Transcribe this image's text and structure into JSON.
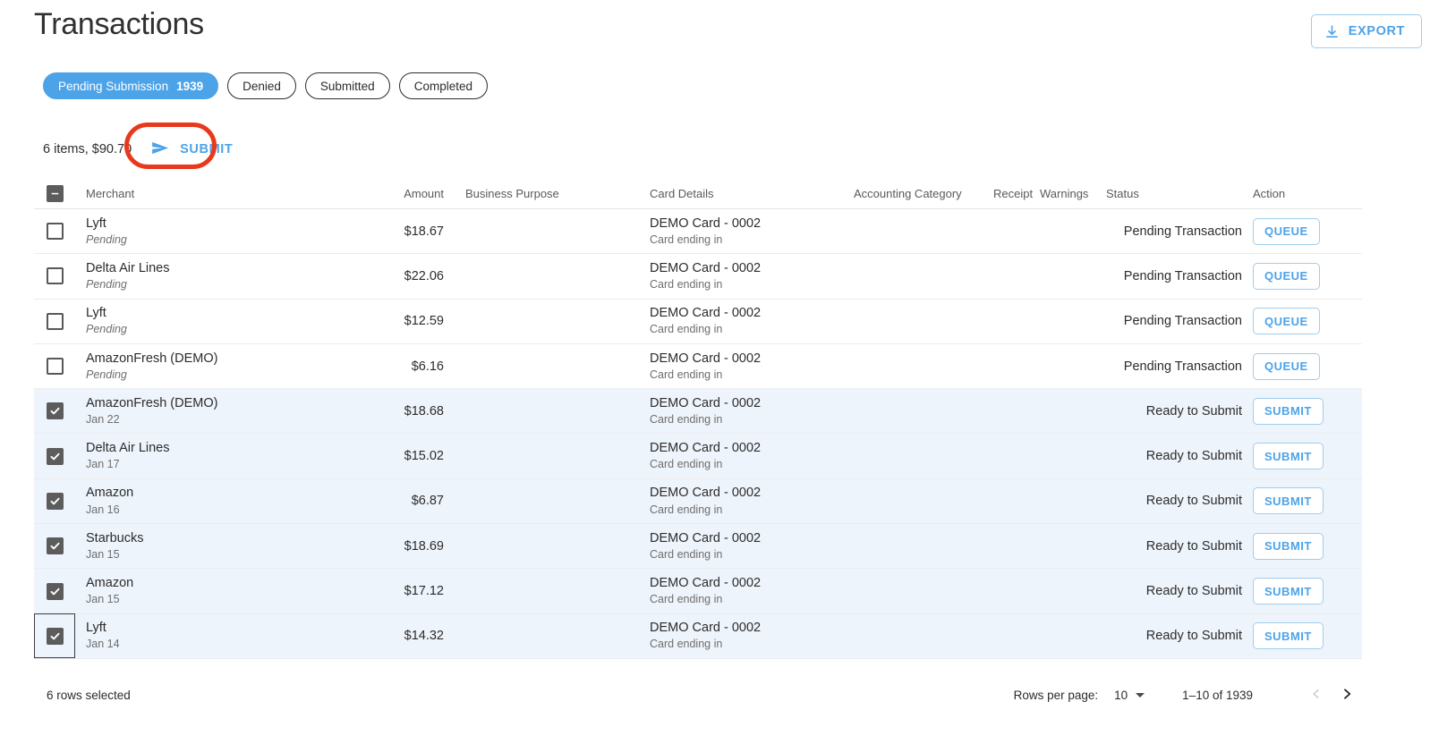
{
  "header": {
    "title": "Transactions",
    "export_label": "EXPORT",
    "export_icon": "download-icon"
  },
  "filters": [
    {
      "label": "Pending Submission",
      "count": "1939",
      "active": true
    },
    {
      "label": "Denied",
      "count": "",
      "active": false
    },
    {
      "label": "Submitted",
      "count": "",
      "active": false
    },
    {
      "label": "Completed",
      "count": "",
      "active": false
    }
  ],
  "toolbar": {
    "summary": "6 items, $90.70",
    "submit_label": "SUBMIT",
    "submit_icon": "send-icon",
    "highlight_color": "#e8391c"
  },
  "table": {
    "columns": {
      "merchant": "Merchant",
      "amount": "Amount",
      "business_purpose": "Business Purpose",
      "card_details": "Card Details",
      "accounting_category": "Accounting Category",
      "receipt": "Receipt",
      "warnings": "Warnings",
      "status": "Status",
      "action": "Action"
    },
    "select_all_state": "indeterminate",
    "rows": [
      {
        "merchant": "Lyft",
        "sub": "Pending",
        "sub_italic": true,
        "amount": "$18.67",
        "business_purpose": "",
        "card": "DEMO Card - 0002",
        "card_sub": "Card ending in",
        "accounting_category": "",
        "receipt": "",
        "warnings": "",
        "status": "Pending Transaction",
        "action": "QUEUE",
        "selected": false,
        "focused": false
      },
      {
        "merchant": "Delta Air Lines",
        "sub": "Pending",
        "sub_italic": true,
        "amount": "$22.06",
        "business_purpose": "",
        "card": "DEMO Card - 0002",
        "card_sub": "Card ending in",
        "accounting_category": "",
        "receipt": "",
        "warnings": "",
        "status": "Pending Transaction",
        "action": "QUEUE",
        "selected": false,
        "focused": false
      },
      {
        "merchant": "Lyft",
        "sub": "Pending",
        "sub_italic": true,
        "amount": "$12.59",
        "business_purpose": "",
        "card": "DEMO Card - 0002",
        "card_sub": "Card ending in",
        "accounting_category": "",
        "receipt": "",
        "warnings": "",
        "status": "Pending Transaction",
        "action": "QUEUE",
        "selected": false,
        "focused": false
      },
      {
        "merchant": "AmazonFresh (DEMO)",
        "sub": "Pending",
        "sub_italic": true,
        "amount": "$6.16",
        "business_purpose": "",
        "card": "DEMO Card - 0002",
        "card_sub": "Card ending in",
        "accounting_category": "",
        "receipt": "",
        "warnings": "",
        "status": "Pending Transaction",
        "action": "QUEUE",
        "selected": false,
        "focused": false
      },
      {
        "merchant": "AmazonFresh (DEMO)",
        "sub": "Jan 22",
        "sub_italic": false,
        "amount": "$18.68",
        "business_purpose": "",
        "card": "DEMO Card - 0002",
        "card_sub": "Card ending in",
        "accounting_category": "",
        "receipt": "",
        "warnings": "",
        "status": "Ready to Submit",
        "action": "SUBMIT",
        "selected": true,
        "focused": false
      },
      {
        "merchant": "Delta Air Lines",
        "sub": "Jan 17",
        "sub_italic": false,
        "amount": "$15.02",
        "business_purpose": "",
        "card": "DEMO Card - 0002",
        "card_sub": "Card ending in",
        "accounting_category": "",
        "receipt": "",
        "warnings": "",
        "status": "Ready to Submit",
        "action": "SUBMIT",
        "selected": true,
        "focused": false
      },
      {
        "merchant": "Amazon",
        "sub": "Jan 16",
        "sub_italic": false,
        "amount": "$6.87",
        "business_purpose": "",
        "card": "DEMO Card - 0002",
        "card_sub": "Card ending in",
        "accounting_category": "",
        "receipt": "",
        "warnings": "",
        "status": "Ready to Submit",
        "action": "SUBMIT",
        "selected": true,
        "focused": false
      },
      {
        "merchant": "Starbucks",
        "sub": "Jan 15",
        "sub_italic": false,
        "amount": "$18.69",
        "business_purpose": "",
        "card": "DEMO Card - 0002",
        "card_sub": "Card ending in",
        "accounting_category": "",
        "receipt": "",
        "warnings": "",
        "status": "Ready to Submit",
        "action": "SUBMIT",
        "selected": true,
        "focused": false
      },
      {
        "merchant": "Amazon",
        "sub": "Jan 15",
        "sub_italic": false,
        "amount": "$17.12",
        "business_purpose": "",
        "card": "DEMO Card - 0002",
        "card_sub": "Card ending in",
        "accounting_category": "",
        "receipt": "",
        "warnings": "",
        "status": "Ready to Submit",
        "action": "SUBMIT",
        "selected": true,
        "focused": false
      },
      {
        "merchant": "Lyft",
        "sub": "Jan 14",
        "sub_italic": false,
        "amount": "$14.32",
        "business_purpose": "",
        "card": "DEMO Card - 0002",
        "card_sub": "Card ending in",
        "accounting_category": "",
        "receipt": "",
        "warnings": "",
        "status": "Ready to Submit",
        "action": "SUBMIT",
        "selected": true,
        "focused": true
      }
    ]
  },
  "footer": {
    "rows_selected": "6 rows selected",
    "rows_per_page_label": "Rows per page:",
    "rows_per_page_value": "10",
    "range": "1–10 of 1939",
    "prev_icon": "chevron-left-icon",
    "next_icon": "chevron-right-icon",
    "prev_disabled": true
  },
  "colors": {
    "accent": "#4da3e8",
    "selected_row": "#eef4fb",
    "highlight": "#e8391c"
  }
}
